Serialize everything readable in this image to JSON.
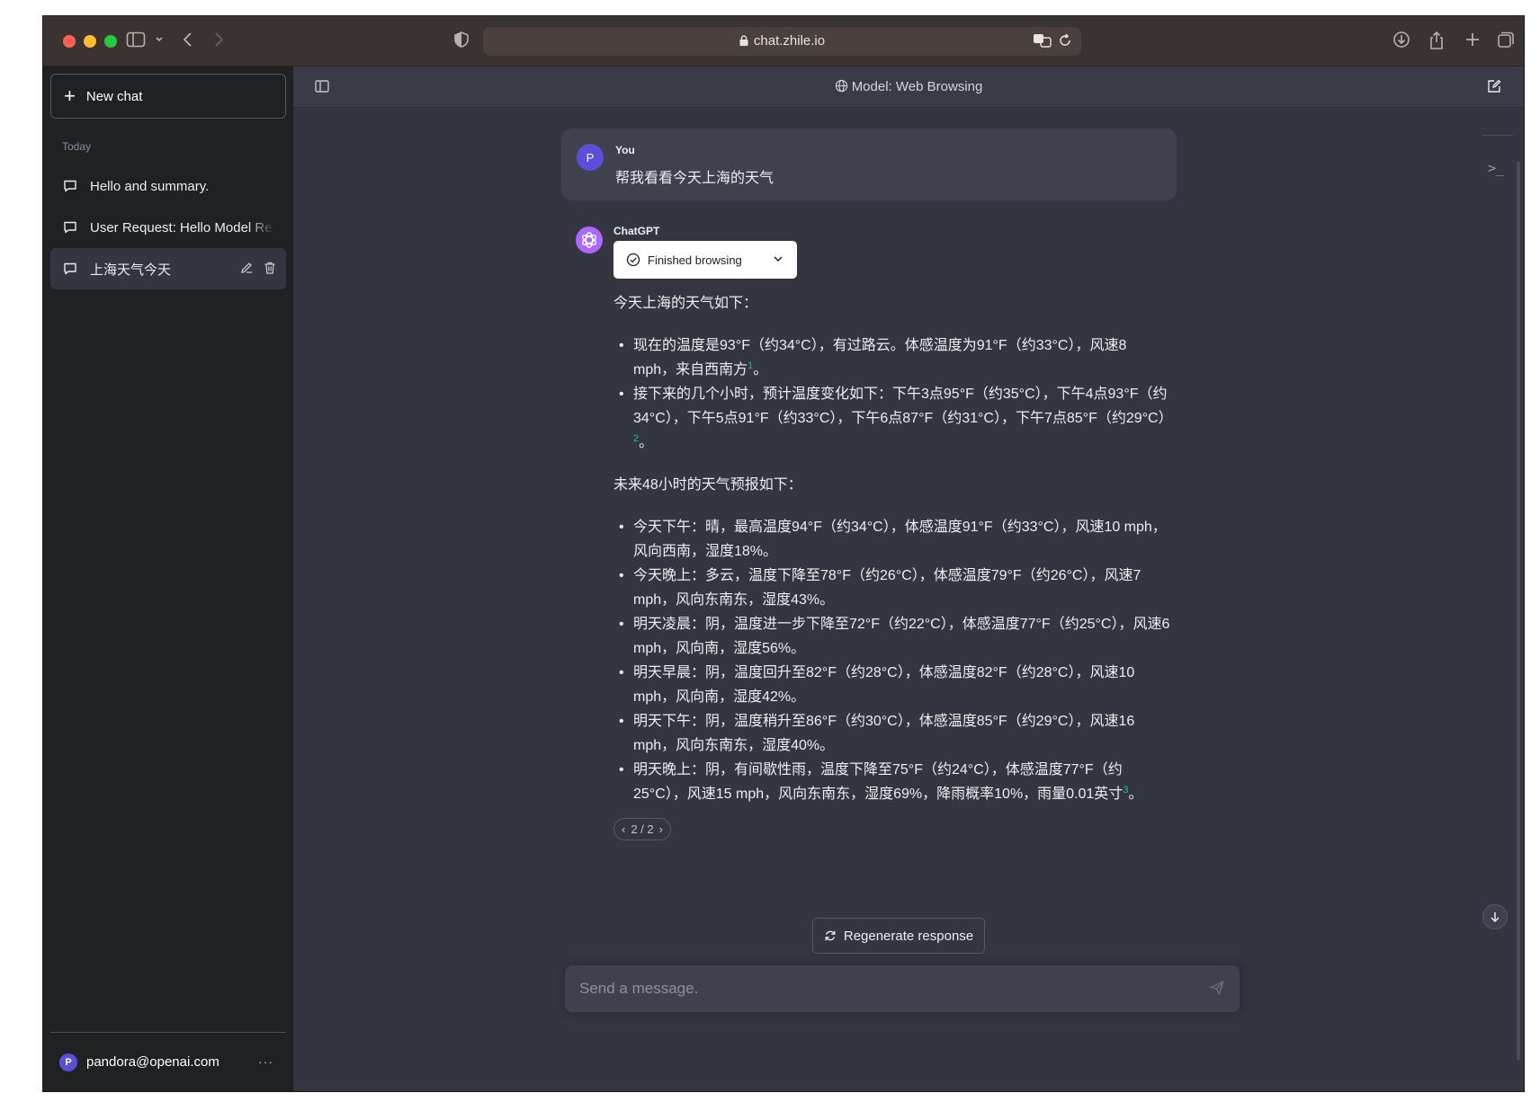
{
  "browser": {
    "url": "chat.zhile.io"
  },
  "sidebar": {
    "new_chat_label": "New chat",
    "section_label": "Today",
    "conversations": [
      {
        "label": "Hello and summary."
      },
      {
        "label": "User Request: Hello Model Response"
      },
      {
        "label": "上海天气今天"
      }
    ],
    "account": {
      "avatar_letter": "P",
      "email": "pandora@openai.com",
      "more_label": "···"
    }
  },
  "header": {
    "model_label": "Model: Web Browsing"
  },
  "conversation": {
    "user": {
      "avatar_letter": "P",
      "name": "You",
      "text": "帮我看看今天上海的天气"
    },
    "assistant": {
      "name": "ChatGPT",
      "browsing_status": "Finished browsing",
      "intro": "今天上海的天气如下：",
      "current_items": [
        {
          "text": "现在的温度是93°F（约34°C），有过路云。体感温度为91°F（约33°C），风速8 mph，来自西南方",
          "ref": "1",
          "end": "。"
        },
        {
          "text": "接下来的几个小时，预计温度变化如下：下午3点95°F（约35°C），下午4点93°F（约34°C），下午5点91°F（约33°C），下午6点87°F（约31°C），下午7点85°F（约29°C）",
          "ref": "2",
          "end": "。"
        }
      ],
      "forecast_intro": "未来48小时的天气预报如下：",
      "forecast_items": [
        {
          "text": "今天下午：晴，最高温度94°F（约34°C），体感温度91°F（约33°C），风速10 mph，风向西南，湿度18%。",
          "ref": "",
          "end": ""
        },
        {
          "text": "今天晚上：多云，温度下降至78°F（约26°C），体感温度79°F（约26°C），风速7 mph，风向东南东，湿度43%。",
          "ref": "",
          "end": ""
        },
        {
          "text": "明天凌晨：阴，温度进一步下降至72°F（约22°C），体感温度77°F（约25°C），风速6 mph，风向南，湿度56%。",
          "ref": "",
          "end": ""
        },
        {
          "text": "明天早晨：阴，温度回升至82°F（约28°C），体感温度82°F（约28°C），风速10 mph，风向南，湿度42%。",
          "ref": "",
          "end": ""
        },
        {
          "text": "明天下午：阴，温度稍升至86°F（约30°C），体感温度85°F（约29°C），风速16 mph，风向东南东，湿度40%。",
          "ref": "",
          "end": ""
        },
        {
          "text": "明天晚上：阴，有间歇性雨，温度下降至75°F（约24°C），体感温度77°F（约25°C），风速15 mph，风向东南东，湿度69%，降雨概率10%，雨量0.01英寸",
          "ref": "3",
          "end": "。"
        }
      ],
      "pager": {
        "prev": "‹",
        "label": "2 / 2",
        "next": "›"
      }
    }
  },
  "composer": {
    "regenerate_label": "Regenerate response",
    "placeholder": "Send a message."
  },
  "colors": {
    "sidebar_bg": "#202123",
    "main_bg": "#343541",
    "user_bubble": "#40414f",
    "user_avatar": "#5b4fd9",
    "gpt_avatar": "#ab68ff",
    "citation": "#19c37d"
  }
}
